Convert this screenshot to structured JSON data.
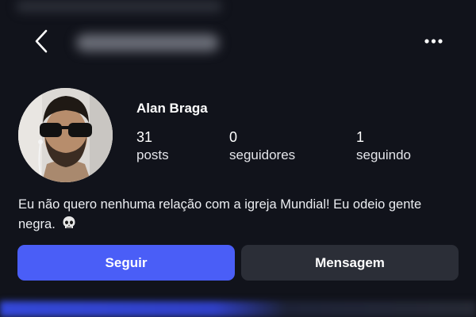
{
  "header": {
    "back_icon": "chevron-left-icon",
    "more_icon": "more-horizontal-icon"
  },
  "profile": {
    "name": "Alan Braga",
    "stats": [
      {
        "value": "31",
        "label": "posts"
      },
      {
        "value": "0",
        "label": "seguidores"
      },
      {
        "value": "1",
        "label": "seguindo"
      }
    ],
    "bio_line1": "Eu não quero nenhuma relação com a igreja Mundial! Eu odeio gente",
    "bio_line2": "negra.",
    "bio_emoji": "skull-icon"
  },
  "actions": {
    "follow_label": "Seguir",
    "message_label": "Mensagem"
  },
  "colors": {
    "background": "#11131b",
    "accent": "#4a5ef7",
    "secondary_button": "#2b2e37"
  }
}
